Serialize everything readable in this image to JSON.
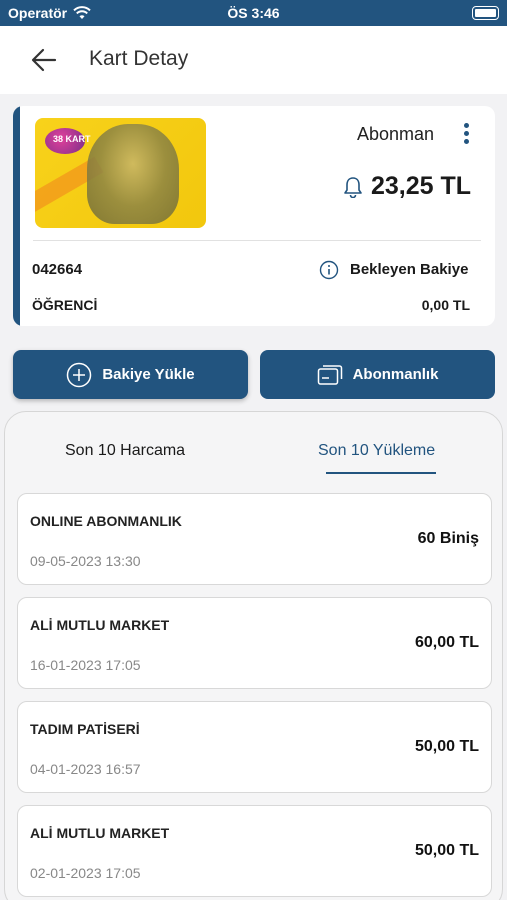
{
  "status_bar": {
    "carrier": "Operatör",
    "time": "ÖS 3:46"
  },
  "header": {
    "title": "Kart Detay"
  },
  "card": {
    "type": "Abonman",
    "balance": "23,25 TL",
    "number": "042664",
    "pending_label": "Bekleyen Bakiye",
    "category": "ÖĞRENCİ",
    "pending_value": "0,00 TL",
    "image_logo_text": "38 KART"
  },
  "actions": {
    "load_balance": "Bakiye Yükle",
    "subscription": "Abonmanlık"
  },
  "tabs": {
    "spending": "Son 10 Harcama",
    "loading": "Son 10 Yükleme",
    "active": "loading"
  },
  "transactions": [
    {
      "name": "ONLINE ABONMANLIK",
      "date": "09-05-2023 13:30",
      "amount": "60 Biniş"
    },
    {
      "name": "ALİ MUTLU MARKET",
      "date": "16-01-2023 17:05",
      "amount": "60,00 TL"
    },
    {
      "name": "TADIM PATİSERİ",
      "date": "04-01-2023 16:57",
      "amount": "50,00 TL"
    },
    {
      "name": "ALİ MUTLU MARKET",
      "date": "02-01-2023 17:05",
      "amount": "50,00 TL"
    }
  ],
  "colors": {
    "primary": "#22547f",
    "background": "#f2f2f4",
    "card_yellow": "#f8d21b"
  },
  "icons": {
    "back": "arrow-left-icon",
    "wifi": "wifi-icon",
    "battery": "battery-icon",
    "more": "more-vertical-icon",
    "bell": "bell-icon",
    "info": "info-icon",
    "plus": "plus-circle-icon",
    "card": "card-icon"
  }
}
